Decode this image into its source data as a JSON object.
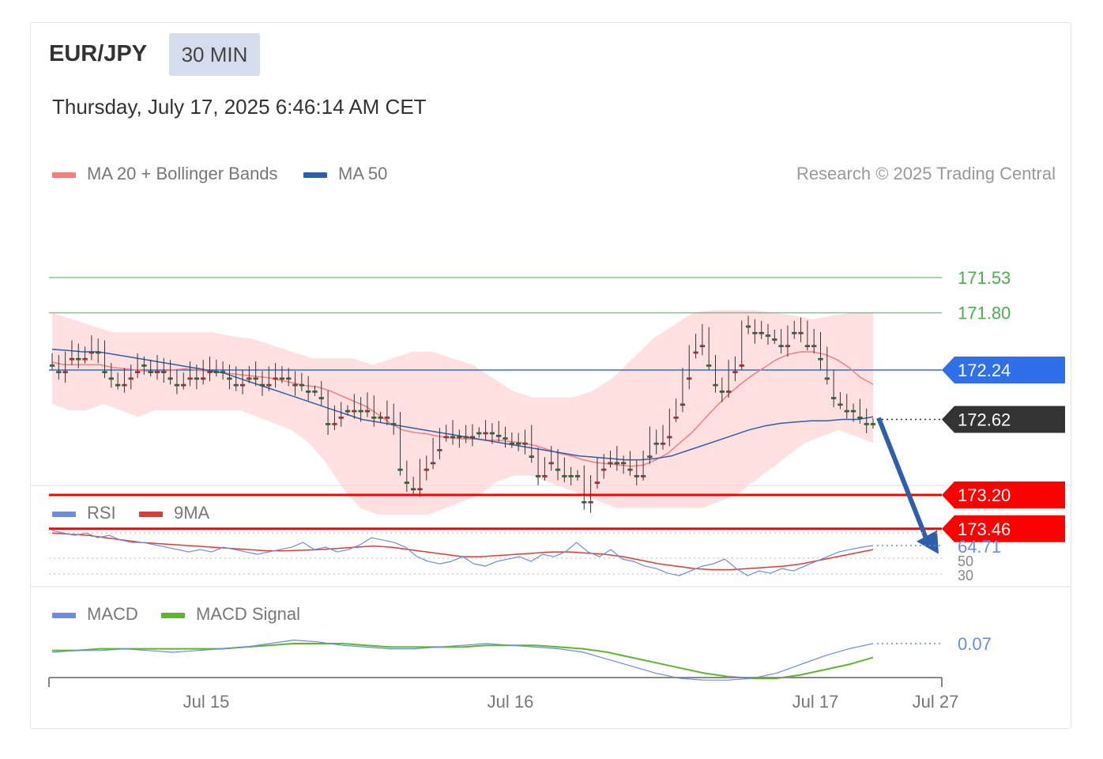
{
  "header": {
    "symbol": "EUR/JPY",
    "timeframe": "30 MIN",
    "datetime": "Thursday, July 17, 2025 6:46:14 AM CET",
    "credit": "Research © 2025 Trading Central"
  },
  "legend": {
    "ma20": "MA 20 + Bollinger Bands",
    "ma50": "MA 50",
    "rsi": "RSI",
    "rsi_ma": "9MA",
    "macd": "MACD",
    "macd_signal": "MACD Signal"
  },
  "colors": {
    "resistance": "#ff0000",
    "support": "#2f6fe8",
    "target": "#4caf50",
    "current": "#333333",
    "candle_up": "#2e7d32",
    "candle_down": "#d32f2f",
    "bollinger": "#ffd6d6",
    "ma20": "#f08080",
    "ma50": "#2e5fa8",
    "rsi": "#6a8de0",
    "rsi_ma": "#e53935",
    "macd": "#6a8de0",
    "macd_signal": "#5cb82a",
    "arrow": "#2e5fa8"
  },
  "chart_data": [
    {
      "type": "candlestick",
      "x_ticks": [
        "Jul 15",
        "Jul 16",
        "Jul 17",
        "Jul 27"
      ],
      "levels": [
        {
          "value": 173.46,
          "label": "173.46",
          "kind": "resistance"
        },
        {
          "value": 173.2,
          "label": "173.20",
          "kind": "resistance"
        },
        {
          "value": 172.62,
          "label": "172.62",
          "kind": "current"
        },
        {
          "value": 172.24,
          "label": "172.24",
          "kind": "support"
        },
        {
          "value": 171.8,
          "label": "171.80",
          "kind": "target"
        },
        {
          "value": 171.53,
          "label": "171.53",
          "kind": "target"
        }
      ],
      "close": [
        172.2,
        172.25,
        172.15,
        172.1,
        172.15,
        172.1,
        172.05,
        172.1,
        172.25,
        172.3,
        172.35,
        172.3,
        172.25,
        172.2,
        172.2,
        172.25,
        172.2,
        172.25,
        172.3,
        172.35,
        172.3,
        172.25,
        172.3,
        172.25,
        172.2,
        172.25,
        172.25,
        172.3,
        172.35,
        172.3,
        172.25,
        172.3,
        172.35,
        172.3,
        172.25,
        172.3,
        172.3,
        172.35,
        172.35,
        172.4,
        172.4,
        172.45,
        172.65,
        172.6,
        172.55,
        172.55,
        172.5,
        172.55,
        172.5,
        172.6,
        172.6,
        172.55,
        172.65,
        173.0,
        173.1,
        173.15,
        173.0,
        172.95,
        172.85,
        172.75,
        172.7,
        172.75,
        172.75,
        172.75,
        172.72,
        172.72,
        172.7,
        172.72,
        172.74,
        172.76,
        172.8,
        172.8,
        172.75,
        172.9,
        173.05,
        172.95,
        172.9,
        173.0,
        173.05,
        173.05,
        173.05,
        173.25,
        173.1,
        173.0,
        172.95,
        172.9,
        172.95,
        172.95,
        173.0,
        173.05,
        172.9,
        172.75,
        172.8,
        172.75,
        172.6,
        172.5,
        172.3,
        172.1,
        172.05,
        171.95,
        172.2,
        172.35,
        172.4,
        172.25,
        172.2,
        171.9,
        171.9,
        171.95,
        171.95,
        171.97,
        172.0,
        172.05,
        171.95,
        171.95,
        171.9,
        172.05,
        172.0,
        172.15,
        172.3,
        172.45,
        172.5,
        172.55,
        172.55,
        172.6,
        172.65,
        172.65
      ],
      "ma20": [
        172.18,
        172.2,
        172.2,
        172.2,
        172.2,
        172.22,
        172.23,
        172.24,
        172.25,
        172.25,
        172.24,
        172.23,
        172.24,
        172.25,
        172.26,
        172.27,
        172.28,
        172.29,
        172.3,
        172.32,
        172.34,
        172.36,
        172.37,
        172.4,
        172.44,
        172.48,
        172.52,
        172.58,
        172.65,
        172.7,
        172.72,
        172.73,
        172.75,
        172.76,
        172.77,
        172.77,
        172.78,
        172.78,
        172.79,
        172.8,
        172.82,
        172.85,
        172.88,
        172.9,
        172.93,
        172.95,
        172.96,
        172.97,
        172.98,
        172.97,
        172.93,
        172.88,
        172.8,
        172.72,
        172.62,
        172.52,
        172.43,
        172.35,
        172.28,
        172.22,
        172.16,
        172.12,
        172.1,
        172.1,
        172.12,
        172.16,
        172.22,
        172.3,
        172.35
      ],
      "ma50": [
        172.08,
        172.09,
        172.1,
        172.1,
        172.12,
        172.14,
        172.16,
        172.18,
        172.2,
        172.22,
        172.24,
        172.26,
        172.3,
        172.34,
        172.38,
        172.42,
        172.46,
        172.5,
        172.54,
        172.58,
        172.62,
        172.64,
        172.66,
        172.68,
        172.7,
        172.72,
        172.74,
        172.76,
        172.78,
        172.8,
        172.82,
        172.84,
        172.86,
        172.88,
        172.9,
        172.91,
        172.92,
        172.93,
        172.93,
        172.92,
        172.9,
        172.86,
        172.82,
        172.78,
        172.74,
        172.7,
        172.67,
        172.65,
        172.64,
        172.63,
        172.63,
        172.62,
        172.62,
        172.6
      ],
      "bb_upper": [
        172.5,
        172.55,
        172.55,
        172.5,
        172.55,
        172.6,
        172.55,
        172.55,
        172.55,
        172.55,
        172.55,
        172.55,
        172.6,
        172.65,
        172.7,
        172.8,
        172.95,
        173.15,
        173.3,
        173.35,
        173.35,
        173.35,
        173.35,
        173.3,
        173.25,
        173.2,
        173.1,
        173.05,
        173.05,
        173.1,
        173.15,
        173.2,
        173.25,
        173.3,
        173.3,
        173.3,
        173.3,
        173.3,
        173.3,
        173.25,
        173.2,
        173.1,
        173.0,
        172.9,
        172.8,
        172.75,
        172.7,
        172.75,
        172.8
      ],
      "bb_lower": [
        171.8,
        171.85,
        171.9,
        171.95,
        171.95,
        171.95,
        171.95,
        171.95,
        171.95,
        171.98,
        172.0,
        172.05,
        172.1,
        172.15,
        172.15,
        172.15,
        172.2,
        172.15,
        172.1,
        172.1,
        172.15,
        172.2,
        172.3,
        172.4,
        172.45,
        172.45,
        172.45,
        172.4,
        172.3,
        172.15,
        172.0,
        171.9,
        171.8,
        171.78,
        171.78,
        171.78,
        171.8,
        171.82,
        171.85,
        171.82,
        171.8,
        171.8
      ]
    },
    {
      "type": "line",
      "name": "RSI",
      "value_label": "64.71",
      "levels": [
        "50",
        "30"
      ],
      "rsi": [
        71,
        70,
        69,
        70,
        68,
        69,
        67,
        66,
        66,
        65,
        64,
        63,
        62,
        63,
        62,
        64,
        63,
        62,
        61,
        62,
        63,
        64,
        66,
        63,
        64,
        62,
        63,
        65,
        68,
        67,
        66,
        64,
        60,
        58,
        57,
        58,
        60,
        57,
        56,
        58,
        59,
        60,
        58,
        61,
        60,
        62,
        66,
        62,
        60,
        63,
        59,
        58,
        56,
        55,
        53,
        52,
        54,
        56,
        57,
        59,
        55,
        52,
        54,
        53,
        55,
        54,
        56,
        58,
        60,
        62,
        63,
        64,
        64.71
      ],
      "rsi_ma": [
        70,
        69.5,
        69,
        68,
        67,
        66,
        65.5,
        65,
        64.5,
        64,
        63.5,
        63,
        62.5,
        62.5,
        62.7,
        63,
        63.5,
        64,
        64.5,
        64,
        63,
        62,
        61,
        60,
        60,
        60.5,
        61,
        61.5,
        62,
        62,
        61.5,
        61,
        60,
        58.5,
        57,
        56,
        55,
        54.5,
        54.5,
        55,
        55.5,
        56,
        57,
        58.5,
        60,
        61.5,
        63
      ]
    },
    {
      "type": "line",
      "name": "MACD",
      "value_label": "0.07",
      "macd": [
        0.02,
        0.03,
        0.03,
        0.04,
        0.03,
        0.02,
        0.03,
        0.04,
        0.05,
        0.07,
        0.09,
        0.08,
        0.06,
        0.05,
        0.04,
        0.04,
        0.05,
        0.06,
        0.07,
        0.06,
        0.05,
        0.04,
        0.02,
        -0.02,
        -0.06,
        -0.1,
        -0.13,
        -0.14,
        -0.14,
        -0.13,
        -0.1,
        -0.05,
        0.0,
        0.04,
        0.07
      ],
      "signal": [
        0.03,
        0.03,
        0.04,
        0.04,
        0.04,
        0.04,
        0.04,
        0.04,
        0.05,
        0.06,
        0.07,
        0.07,
        0.07,
        0.06,
        0.05,
        0.05,
        0.05,
        0.05,
        0.06,
        0.06,
        0.06,
        0.05,
        0.04,
        0.02,
        -0.01,
        -0.04,
        -0.07,
        -0.1,
        -0.12,
        -0.13,
        -0.13,
        -0.11,
        -0.08,
        -0.05,
        -0.01
      ]
    }
  ]
}
